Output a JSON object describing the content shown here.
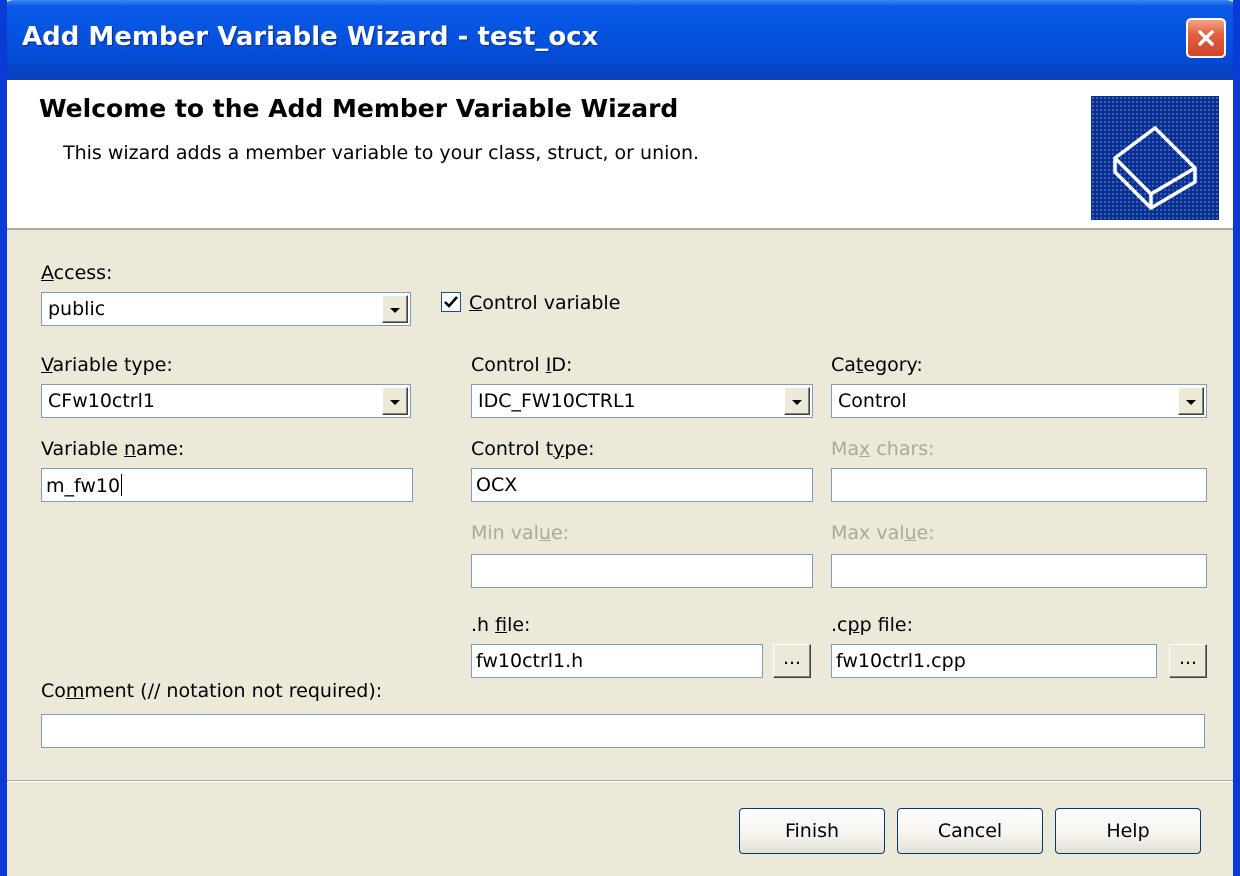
{
  "window": {
    "title": "Add Member Variable Wizard - test_ocx"
  },
  "header": {
    "title": "Welcome to the Add Member Variable Wizard",
    "subtitle": "This wizard adds a member variable to your class, struct, or union."
  },
  "form": {
    "access": {
      "label_pre": "",
      "label_key": "A",
      "label_post": "ccess:",
      "value": "public"
    },
    "control_variable": {
      "label_pre": "",
      "label_key": "C",
      "label_post": "ontrol variable",
      "checked": true
    },
    "variable_type": {
      "label_pre": "",
      "label_key": "V",
      "label_post": "ariable type:",
      "value": "CFw10ctrl1"
    },
    "control_id": {
      "label_pre": "Control ",
      "label_key": "I",
      "label_post": "D:",
      "value": "IDC_FW10CTRL1"
    },
    "category": {
      "label_pre": "Ca",
      "label_key": "t",
      "label_post": "egory:",
      "value": "Control"
    },
    "variable_name": {
      "label_pre": "Variable ",
      "label_key": "n",
      "label_post": "ame:",
      "value": "m_fw10"
    },
    "control_type": {
      "label_pre": "Control t",
      "label_key": "y",
      "label_post": "pe:",
      "value": "OCX"
    },
    "max_chars": {
      "label_pre": "Ma",
      "label_key": "x",
      "label_post": " chars:",
      "value": ""
    },
    "min_value": {
      "label_pre": "Min val",
      "label_key": "u",
      "label_post": "e:",
      "value": ""
    },
    "max_value": {
      "label_pre": "Max val",
      "label_key": "u",
      "label_post": "e:",
      "value": ""
    },
    "h_file": {
      "label_pre": ".h ",
      "label_key": "f",
      "label_post": "ile:",
      "value": "fw10ctrl1.h"
    },
    "cpp_file": {
      "label_pre": ".c",
      "label_key": "p",
      "label_post": "p file:",
      "value": "fw10ctrl1.cpp"
    },
    "comment": {
      "label_pre": "Co",
      "label_key": "m",
      "label_post": "ment (// notation not required):",
      "value": ""
    },
    "browse_label": "..."
  },
  "buttons": {
    "finish": "Finish",
    "cancel": "Cancel",
    "help": "Help"
  },
  "colors": {
    "titlebar": "#0653e0",
    "dialog_bg": "#ece9d8",
    "disabled_text": "#aca899",
    "close_button": "#d2452a"
  }
}
